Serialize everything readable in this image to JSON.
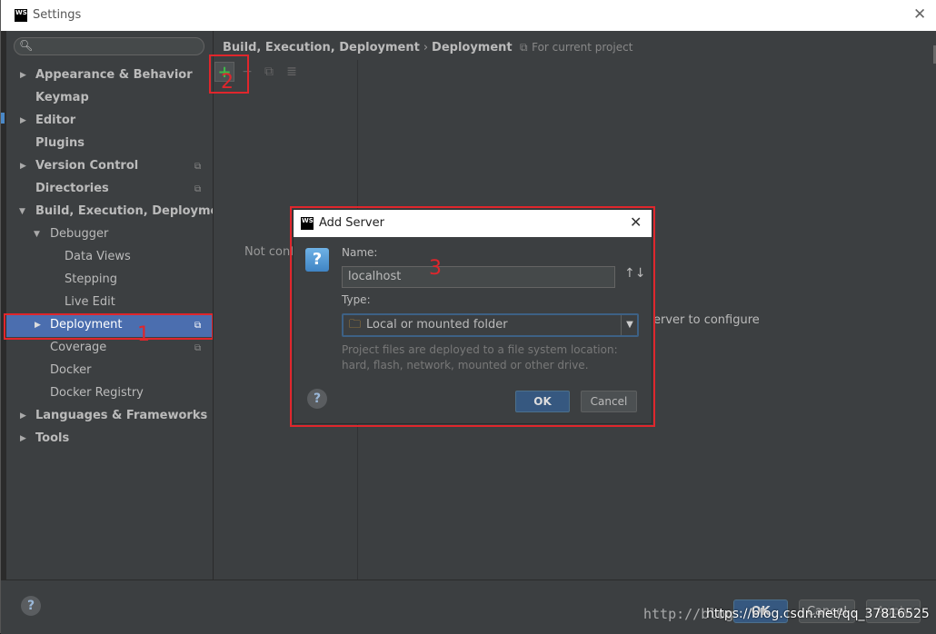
{
  "window": {
    "title": "Settings",
    "logo_text": "WS"
  },
  "search": {
    "placeholder": ""
  },
  "sidebar": {
    "items": [
      {
        "label": "Appearance & Behavior"
      },
      {
        "label": "Keymap"
      },
      {
        "label": "Editor"
      },
      {
        "label": "Plugins"
      },
      {
        "label": "Version Control"
      },
      {
        "label": "Directories"
      },
      {
        "label": "Build, Execution, Deployment"
      },
      {
        "label": "Debugger"
      },
      {
        "label": "Data Views"
      },
      {
        "label": "Stepping"
      },
      {
        "label": "Live Edit"
      },
      {
        "label": "Deployment"
      },
      {
        "label": "Coverage"
      },
      {
        "label": "Docker"
      },
      {
        "label": "Docker Registry"
      },
      {
        "label": "Languages & Frameworks"
      },
      {
        "label": "Tools"
      }
    ]
  },
  "breadcrumb": {
    "part1": "Build, Execution, Deployment",
    "part2": "Deployment",
    "scope": "For current project"
  },
  "main": {
    "not_configured": "Not conf",
    "configure_hint": "erver to configure"
  },
  "annotations": {
    "n1": "1",
    "n2": "2",
    "n3": "3"
  },
  "dialog": {
    "title": "Add Server",
    "name_label": "Name:",
    "name_value": "localhost",
    "type_label": "Type:",
    "type_value": "Local or mounted folder",
    "description": "Project files are deployed to a file system location: hard, flash, network, mounted or other drive.",
    "ok": "OK",
    "cancel": "Cancel"
  },
  "bottom": {
    "ok": "OK",
    "cancel": "Cancel",
    "apply": "Apply"
  },
  "watermark": {
    "text1": "http://blog",
    "text2": "https://blog.csdn.net/qq_37816525"
  },
  "colors": {
    "accent": "#4b6eaf",
    "annotation": "#e0262c",
    "add_icon": "#3eb84a"
  }
}
